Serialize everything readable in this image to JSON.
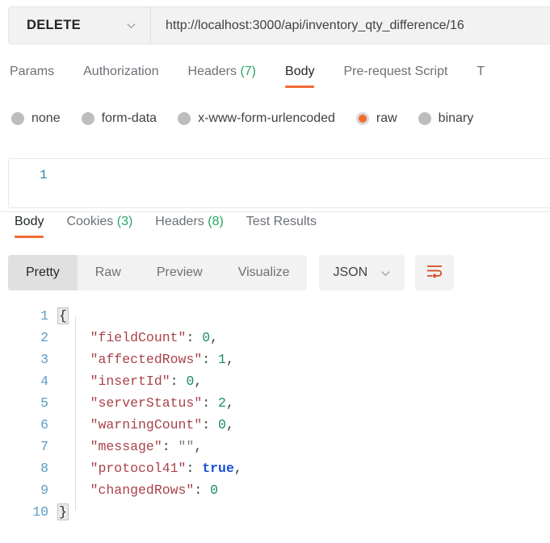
{
  "request": {
    "method": "DELETE",
    "url": "http://localhost:3000/api/inventory_qty_difference/16",
    "tabs": [
      {
        "label": "Params",
        "active": false
      },
      {
        "label": "Authorization",
        "active": false
      },
      {
        "label": "Headers",
        "count": "(7)",
        "active": false
      },
      {
        "label": "Body",
        "active": true
      },
      {
        "label": "Pre-request Script",
        "active": false
      },
      {
        "label": "T",
        "active": false
      }
    ],
    "body_types": [
      {
        "label": "none",
        "selected": false
      },
      {
        "label": "form-data",
        "selected": false
      },
      {
        "label": "x-www-form-urlencoded",
        "selected": false
      },
      {
        "label": "raw",
        "selected": true
      },
      {
        "label": "binary",
        "selected": false
      }
    ],
    "editor": {
      "line_number": "1",
      "content": ""
    }
  },
  "response": {
    "tabs": [
      {
        "label": "Body",
        "active": true
      },
      {
        "label": "Cookies",
        "count": "(3)",
        "active": false
      },
      {
        "label": "Headers",
        "count": "(8)",
        "active": false
      },
      {
        "label": "Test Results",
        "active": false
      }
    ],
    "view_modes": [
      {
        "label": "Pretty",
        "active": true
      },
      {
        "label": "Raw",
        "active": false
      },
      {
        "label": "Preview",
        "active": false
      },
      {
        "label": "Visualize",
        "active": false
      }
    ],
    "format": "JSON",
    "wrap_icon": "word-wrap-icon",
    "code_lines": [
      {
        "n": "1",
        "tokens": [
          {
            "t": "{",
            "c": "brace"
          }
        ]
      },
      {
        "n": "2",
        "tokens": [
          {
            "t": "    \"fieldCount\"",
            "c": "k"
          },
          {
            "t": ": ",
            "c": "p"
          },
          {
            "t": "0",
            "c": "num"
          },
          {
            "t": ",",
            "c": "p"
          }
        ]
      },
      {
        "n": "3",
        "tokens": [
          {
            "t": "    \"affectedRows\"",
            "c": "k"
          },
          {
            "t": ": ",
            "c": "p"
          },
          {
            "t": "1",
            "c": "num"
          },
          {
            "t": ",",
            "c": "p"
          }
        ]
      },
      {
        "n": "4",
        "tokens": [
          {
            "t": "    \"insertId\"",
            "c": "k"
          },
          {
            "t": ": ",
            "c": "p"
          },
          {
            "t": "0",
            "c": "num"
          },
          {
            "t": ",",
            "c": "p"
          }
        ]
      },
      {
        "n": "5",
        "tokens": [
          {
            "t": "    \"serverStatus\"",
            "c": "k"
          },
          {
            "t": ": ",
            "c": "p"
          },
          {
            "t": "2",
            "c": "num"
          },
          {
            "t": ",",
            "c": "p"
          }
        ]
      },
      {
        "n": "6",
        "tokens": [
          {
            "t": "    \"warningCount\"",
            "c": "k"
          },
          {
            "t": ": ",
            "c": "p"
          },
          {
            "t": "0",
            "c": "num"
          },
          {
            "t": ",",
            "c": "p"
          }
        ]
      },
      {
        "n": "7",
        "tokens": [
          {
            "t": "    \"message\"",
            "c": "k"
          },
          {
            "t": ": ",
            "c": "p"
          },
          {
            "t": "\"\"",
            "c": "str"
          },
          {
            "t": ",",
            "c": "p"
          }
        ]
      },
      {
        "n": "8",
        "tokens": [
          {
            "t": "    \"protocol41\"",
            "c": "k"
          },
          {
            "t": ": ",
            "c": "p"
          },
          {
            "t": "true",
            "c": "bool"
          },
          {
            "t": ",",
            "c": "p"
          }
        ]
      },
      {
        "n": "9",
        "tokens": [
          {
            "t": "    \"changedRows\"",
            "c": "k"
          },
          {
            "t": ": ",
            "c": "p"
          },
          {
            "t": "0",
            "c": "num"
          }
        ]
      },
      {
        "n": "10",
        "tokens": [
          {
            "t": "}",
            "c": "brace"
          }
        ]
      }
    ],
    "response_json": {
      "fieldCount": 0,
      "affectedRows": 1,
      "insertId": 0,
      "serverStatus": 2,
      "warningCount": 0,
      "message": "",
      "protocol41": true,
      "changedRows": 0
    }
  },
  "colors": {
    "accent": "#ef6c33",
    "radio_selected": "#f26b29",
    "count_green": "#27a567",
    "wrap_icon": "#d9481f"
  }
}
